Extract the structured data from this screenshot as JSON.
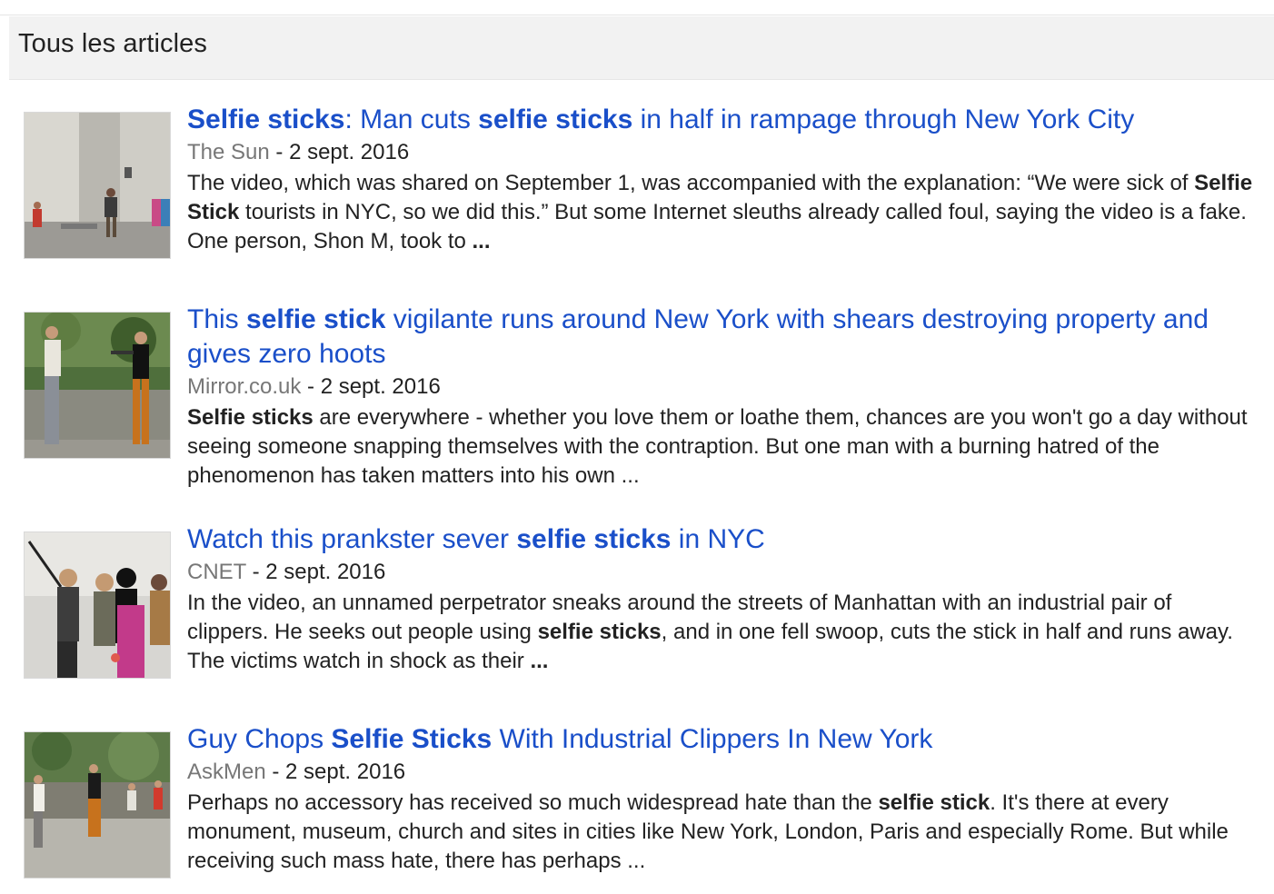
{
  "section": {
    "title": "Tous les articles"
  },
  "articles": [
    {
      "title_parts": [
        {
          "t": "Selfie sticks",
          "b": true
        },
        {
          "t": ": Man cuts ",
          "b": false
        },
        {
          "t": "selfie sticks",
          "b": true
        },
        {
          "t": " in half in rampage through New York City",
          "b": false
        }
      ],
      "source": "The Sun",
      "separator": " - ",
      "date": "2 sept. 2016",
      "snippet_parts": [
        {
          "t": "The video, which was shared on September 1, was accompanied with the explanation: “We were sick of ",
          "b": false
        },
        {
          "t": "Selfie Stick",
          "b": true
        },
        {
          "t": " tourists in NYC, so we did this.” But some Internet sleuths already called foul, saying the video is a fake. One person, Shon M, took to ",
          "b": false
        },
        {
          "t": "...",
          "b": true
        }
      ]
    },
    {
      "title_parts": [
        {
          "t": "This ",
          "b": false
        },
        {
          "t": "selfie stick",
          "b": true
        },
        {
          "t": " vigilante runs around New York with shears destroying property and gives zero hoots",
          "b": false
        }
      ],
      "source": "Mirror.co.uk",
      "separator": " - ",
      "date": "2 sept. 2016",
      "snippet_parts": [
        {
          "t": "Selfie sticks",
          "b": true
        },
        {
          "t": " are everywhere - whether you love them or loathe them, chances are you won't go a day without seeing someone snapping themselves with the contraption. But one man with a burning hatred of the phenomenon has taken matters into his own ...",
          "b": false
        }
      ]
    },
    {
      "title_parts": [
        {
          "t": "Watch this prankster sever ",
          "b": false
        },
        {
          "t": "selfie sticks",
          "b": true
        },
        {
          "t": " in NYC",
          "b": false
        }
      ],
      "source": "CNET",
      "separator": " - ",
      "date": "2 sept. 2016",
      "snippet_parts": [
        {
          "t": "In the video, an unnamed perpetrator sneaks around the streets of Manhattan with an industrial pair of clippers. He seeks out people using ",
          "b": false
        },
        {
          "t": "selfie sticks",
          "b": true
        },
        {
          "t": ", and in one fell swoop, cuts the stick in half and runs away. The victims watch in shock as their ",
          "b": false
        },
        {
          "t": "...",
          "b": true
        }
      ]
    },
    {
      "title_parts": [
        {
          "t": "Guy Chops ",
          "b": false
        },
        {
          "t": "Selfie Sticks",
          "b": true
        },
        {
          "t": " With Industrial Clippers In New York",
          "b": false
        }
      ],
      "source": "AskMen",
      "separator": " - ",
      "date": "2 sept. 2016",
      "snippet_parts": [
        {
          "t": "Perhaps no accessory has received so much widespread hate than the ",
          "b": false
        },
        {
          "t": "selfie stick",
          "b": true
        },
        {
          "t": ". It's there at every monument, museum, church and sites in cities like New York, London, Paris and especially Rome. But while receiving such mass hate, there has perhaps ...",
          "b": false
        }
      ]
    }
  ]
}
